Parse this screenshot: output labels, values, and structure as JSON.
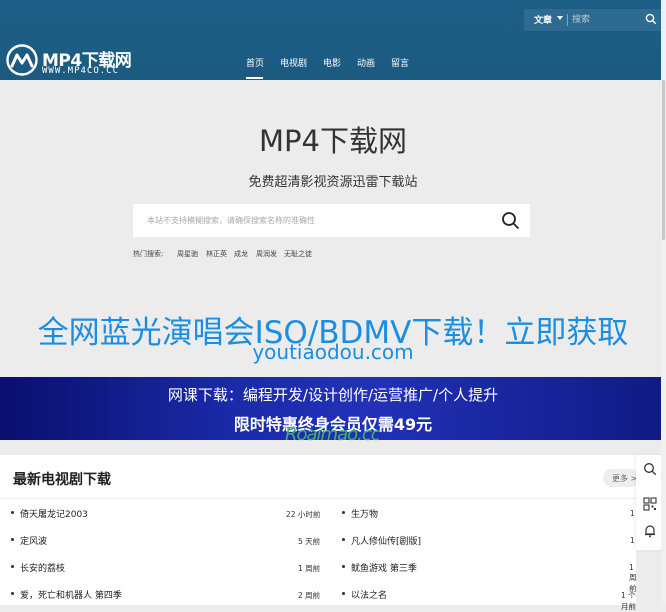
{
  "header": {
    "search_category": "文章",
    "search_placeholder": "搜索",
    "brand": "MP4下载网",
    "domain": "WWW.MP4CO.CC",
    "nav": [
      "首页",
      "电视剧",
      "电影",
      "动画",
      "留言"
    ],
    "active_nav": "首页"
  },
  "hero": {
    "title": "MP4下载网",
    "subtitle": "免费超清影视资源迅雷下载站",
    "search_placeholder": "本站不支持模糊搜索，请确保搜索名称的准确性",
    "hot_label": "热门搜索:",
    "hot_terms": [
      "周星驰",
      "林正英",
      "成龙",
      "周润发",
      "无耻之徒"
    ]
  },
  "promo": {
    "line1": "全网蓝光演唱会ISO/BDMV下载！立即获取",
    "line2": "youtiaodou.com",
    "banner_line1": "网课下载：编程开发/设计创作/运营推广/个人提升",
    "banner_line2": "限时特惠终身会员仅需49元",
    "watermark": "Roaimao.cc"
  },
  "tv_section": {
    "title": "最新电视剧下载",
    "more": "更多 >",
    "left": [
      {
        "name": "倚天屠龙记2003",
        "time": "22 小时前"
      },
      {
        "name": "定风波",
        "time": "5 天前"
      },
      {
        "name": "长安的荔枝",
        "time": "1 周前"
      },
      {
        "name": "爱，死亡和机器人 第四季",
        "time": "2 周前"
      }
    ],
    "right": [
      {
        "name": "生万物",
        "time": "1"
      },
      {
        "name": "凡人修仙传[剧版]",
        "time": "1"
      },
      {
        "name": "鱿鱼游戏 第三季",
        "time": "1 周前"
      },
      {
        "name": "以法之名",
        "time": "1 个月前"
      }
    ]
  }
}
